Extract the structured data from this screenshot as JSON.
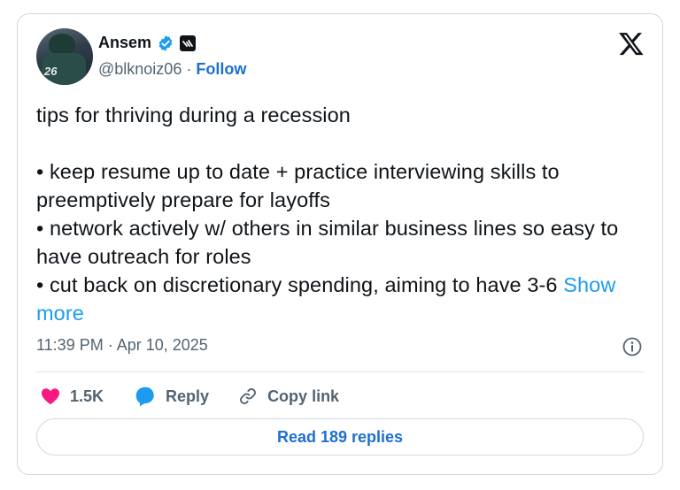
{
  "author": {
    "name": "Ansem",
    "handle": "@blknoiz06",
    "separator": " · ",
    "follow_label": "Follow",
    "avatar_number": "26"
  },
  "icons": {
    "verified": "verified-badge-icon",
    "affiliate": "affiliate-badge-icon",
    "platform": "x-logo-icon",
    "info": "info-icon",
    "like": "heart-icon",
    "reply": "reply-bubble-icon",
    "copy": "link-icon"
  },
  "tweet": {
    "text": "tips for thriving during a recession\n\n• keep resume up to date + practice interviewing skills to preemptively prepare for layoffs\n• network actively w/ others in similar business lines so easy to have outreach for roles\n• cut back on discretionary spending, aiming to have 3-6 ",
    "show_more_label": "Show more",
    "timestamp": "11:39 PM · Apr 10, 2025"
  },
  "actions": {
    "likes_count": "1.5K",
    "reply_label": "Reply",
    "copy_link_label": "Copy link"
  },
  "footer": {
    "read_replies_label": "Read 189 replies"
  },
  "colors": {
    "like": "#f91880",
    "reply": "#1d9bf0",
    "verified": "#1d9bf0",
    "link": "#1d6fd1",
    "secondary_text": "#536471"
  }
}
